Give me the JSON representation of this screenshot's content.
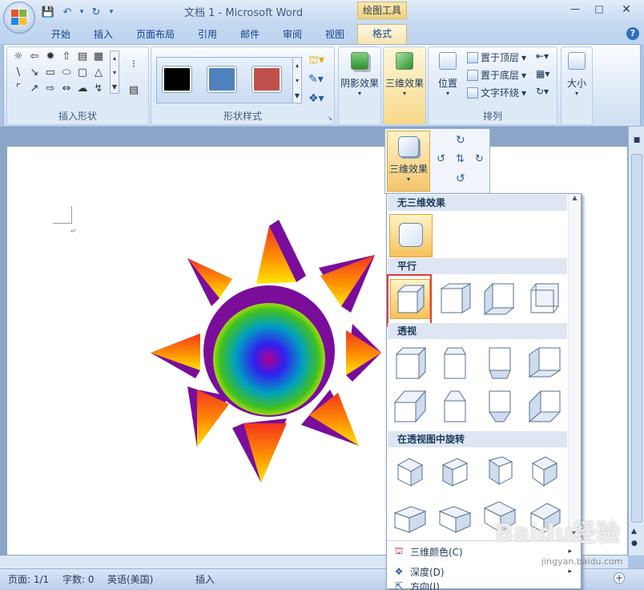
{
  "title": "文档 1 - Microsoft Word",
  "contextual_tab_group": "绘图工具",
  "tabs": [
    "开始",
    "插入",
    "页面布局",
    "引用",
    "邮件",
    "审阅",
    "视图",
    "格式"
  ],
  "active_tab": "格式",
  "help": "?",
  "ribbon": {
    "insert_shapes_label": "插入形状",
    "shape_styles_label": "形状样式",
    "shadow_effects": "阴影效果",
    "threed_effects": "三维效果",
    "position": "位置",
    "bring_to_front": "置于顶层",
    "send_to_back": "置于底层",
    "text_wrap": "文字环绕",
    "arrange_label": "排列",
    "size": "大小",
    "style_colors": [
      "#000000",
      "#4f81bd",
      "#c0504d"
    ]
  },
  "dropdown": {
    "header_button": "三维效果",
    "sections": {
      "none": "无三维效果",
      "parallel": "平行",
      "perspective": "透视",
      "rotate": "在透视图中旋转"
    },
    "menu": {
      "color": "三维颜色(C)",
      "depth": "深度(D)",
      "direction": "方向(I)"
    }
  },
  "status": {
    "page": "页面: 1/1",
    "words": "字数: 0",
    "language": "英语(美国)",
    "mode": "插入"
  },
  "watermark": "Baidu经验 jingyan.baidu.com"
}
